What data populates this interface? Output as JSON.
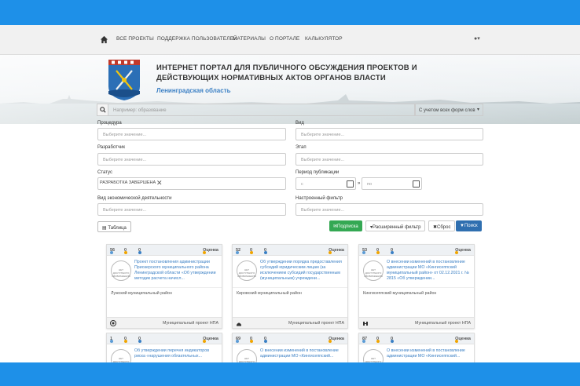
{
  "nav": {
    "items": [
      "ВСЕ ПРОЕКТЫ",
      "ПОДДЕРЖКА ПОЛЬЗОВАТЕЛЕЙ",
      "МАТЕРИАЛЫ",
      "О ПОРТАЛЕ",
      "КАЛЬКУЛЯТОР"
    ]
  },
  "header": {
    "title": "ИНТЕРНЕТ ПОРТАЛ ДЛЯ ПУБЛИЧНОГО ОБСУЖДЕНИЯ ПРОЕКТОВ И ДЕЙСТВУЮЩИХ НОРМАТИВНЫХ АКТОВ ОРГАНОВ ВЛАСТИ",
    "region": "Ленинградская область"
  },
  "search": {
    "placeholder": "Например: образование",
    "mode": "С учетом всех форм слов"
  },
  "filters": {
    "procedure_label": "Процедура",
    "procedure_ph": "Выберите значение...",
    "view_label": "Вид",
    "view_ph": "Выберите значение...",
    "developer_label": "Разработчик",
    "developer_ph": "Выберите значение...",
    "stage_label": "Этап",
    "stage_ph": "Выберите значение...",
    "status_label": "Статус",
    "status_tag": "РАЗРАБОТКА ЗАВЕРШЕНА",
    "period_label": "Период публикации",
    "period_from": "с",
    "period_to": "по",
    "activity_label": "Вид экономической деятельности",
    "activity_ph": "Выберите значение...",
    "custom_label": "Настроенный фильтр",
    "custom_ph": "Выберите значение..."
  },
  "toolbar": {
    "table": "Таблица",
    "subscribe": "Подписка",
    "advanced": "Расширенный фильтр",
    "reset": "Сброс",
    "search": "Поиск"
  },
  "cards": [
    {
      "views": "56",
      "stars": "0",
      "comments": "0",
      "rating": "Оценка",
      "desc": "Проект постановления администрации Приозерского муниципального района Ленинградской области «Об утверждении методик расчета начисл...",
      "muni": "Лужский муниципальный район",
      "type": "Муниципальный проект НПА"
    },
    {
      "views": "52",
      "stars": "0",
      "comments": "0",
      "rating": "Оценка",
      "desc": "Об утверждении порядка предоставления субсидий юридическим лицам (за исключением субсидий государственным (муниципальным) учреждени...",
      "muni": "Кировский муниципальный район",
      "type": "Муниципальный проект НПА"
    },
    {
      "views": "53",
      "stars": "0",
      "comments": "0",
      "rating": "Оценка",
      "desc": "О внесении изменений в постановление администрации МО «Кингисеппский муниципальный район» от 02.12.2021 г. № 2815 «Об утверждении...",
      "muni": "Кингисеппский муниципальный район",
      "type": "Муниципальный проект НПА"
    },
    {
      "views": "1",
      "stars": "0",
      "comments": "0",
      "rating": "Оценка",
      "desc": "Об утверждении перечня индикаторов риска «нарушения обязательных...",
      "muni": "",
      "type": ""
    },
    {
      "views": "69",
      "stars": "0",
      "comments": "0",
      "rating": "Оценка",
      "desc": "О внесении изменений в постановление администрации МО «Кингисеппский...",
      "muni": "",
      "type": ""
    },
    {
      "views": "87",
      "stars": "0",
      "comments": "0",
      "rating": "Оценка",
      "desc": "О внесении изменений в постановление администрации МО «Кингисеппский...",
      "muni": "",
      "type": ""
    }
  ],
  "logo_text": "НЕТ ДОСТУПНОГО ИЗОБРАЖЕНИЯ"
}
